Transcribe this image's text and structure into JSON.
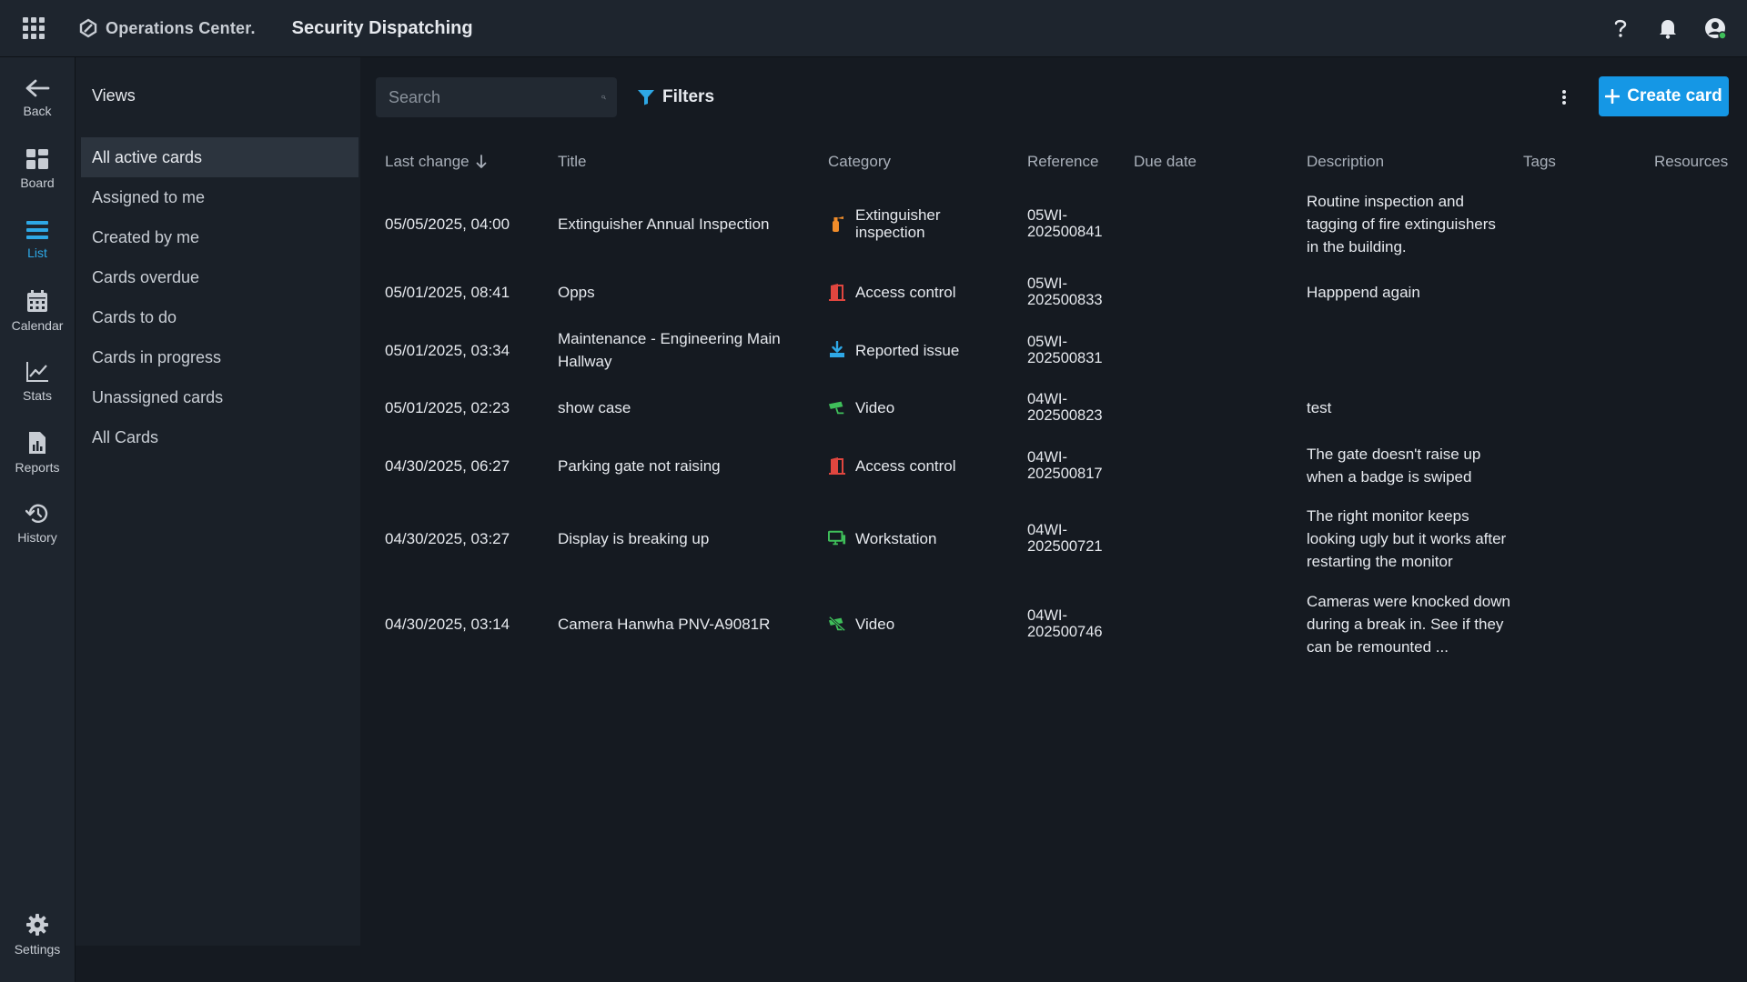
{
  "app": {
    "brand": "Operations Center.",
    "title": "Security Dispatching"
  },
  "rail": [
    {
      "label": "Back",
      "icon": "arrow-left-icon"
    },
    {
      "label": "Board",
      "icon": "board-icon"
    },
    {
      "label": "List",
      "icon": "list-icon",
      "active": true
    },
    {
      "label": "Calendar",
      "icon": "calendar-icon"
    },
    {
      "label": "Stats",
      "icon": "stats-icon"
    },
    {
      "label": "Reports",
      "icon": "reports-icon"
    },
    {
      "label": "History",
      "icon": "history-icon"
    },
    {
      "label": "Settings",
      "icon": "gear-icon"
    }
  ],
  "views": {
    "title": "Views",
    "items": [
      "All active cards",
      "Assigned to me",
      "Created by me",
      "Cards overdue",
      "Cards to do",
      "Cards in progress",
      "Unassigned cards",
      "All Cards"
    ],
    "active_index": 0
  },
  "toolbar": {
    "search_placeholder": "Search",
    "filters_label": "Filters",
    "create_label": "Create card"
  },
  "table": {
    "columns": {
      "last_change": "Last change",
      "title": "Title",
      "category": "Category",
      "reference": "Reference",
      "due_date": "Due date",
      "description": "Description",
      "tags": "Tags",
      "resources": "Resources"
    },
    "sort": {
      "column": "Last change",
      "direction": "desc"
    },
    "rows": [
      {
        "last_change": "05/05/2025, 04:00",
        "title": "Extinguisher Annual Inspection",
        "category": "Extinguisher inspection",
        "category_icon": "fire-extinguisher-icon",
        "category_color": "#f08c2a",
        "reference_1": "05WI-",
        "reference_2": "202500841",
        "due_date": "",
        "description": "Routine inspection and tagging of fire extinguishers in the building."
      },
      {
        "last_change": "05/01/2025, 08:41",
        "title": "Opps",
        "category": "Access control",
        "category_icon": "door-access-icon",
        "category_color": "#e0463f",
        "reference_1": "05WI-",
        "reference_2": "202500833",
        "due_date": "",
        "description": "Happpend again"
      },
      {
        "last_change": "05/01/2025, 03:34",
        "title": "Maintenance - Engineering Main Hallway",
        "category": "Reported issue",
        "category_icon": "download-tray-icon",
        "category_color": "#2ea8e6",
        "reference_1": "05WI-",
        "reference_2": "202500831",
        "due_date": "",
        "description": ""
      },
      {
        "last_change": "05/01/2025, 02:23",
        "title": "show case",
        "category": "Video",
        "category_icon": "camera-icon",
        "category_color": "#3fbf5a",
        "reference_1": "04WI-",
        "reference_2": "202500823",
        "due_date": "",
        "description": "test"
      },
      {
        "last_change": "04/30/2025, 06:27",
        "title": "Parking gate not raising",
        "category": "Access control",
        "category_icon": "door-access-icon",
        "category_color": "#e0463f",
        "reference_1": "04WI-",
        "reference_2": "202500817",
        "due_date": "",
        "description": "The gate doesn't raise up when a badge is swiped"
      },
      {
        "last_change": "04/30/2025, 03:27",
        "title": "Display is breaking up",
        "category": "Workstation",
        "category_icon": "monitor-icon",
        "category_color": "#3fbf5a",
        "reference_1": "04WI-",
        "reference_2": "202500721",
        "due_date": "",
        "description": "The right monitor keeps looking ugly but it works after restarting the monitor"
      },
      {
        "last_change": "04/30/2025, 03:14",
        "title": "Camera Hanwha PNV-A9081R",
        "category": "Video",
        "category_icon": "camera-off-icon",
        "category_color": "#3fbf5a",
        "reference_1": "04WI-",
        "reference_2": "202500746",
        "due_date": "",
        "description": "Cameras were knocked down during a break in. See if they can be remounted ..."
      }
    ]
  }
}
